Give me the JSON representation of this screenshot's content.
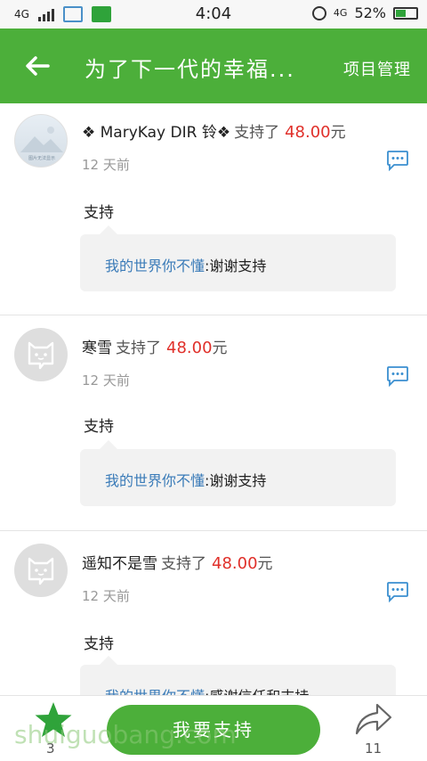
{
  "status_bar": {
    "network_left": "4G",
    "time": "4:04",
    "network_right": "4G",
    "battery": "52%",
    "battery_level": 0.52
  },
  "app_bar": {
    "title": "为了下一代的幸福...",
    "action": "项目管理"
  },
  "comments": [
    {
      "name": "❖ MaryKay  DIR 铃❖",
      "supported": "支持了",
      "amount": "48.00",
      "unit": "元",
      "time": "12 天前",
      "content": "支持",
      "reply_author": "我的世界你不懂",
      "reply_text": ":谢谢支持",
      "avatar_caption": "图片无法显示"
    },
    {
      "name": "寒雪",
      "supported": "支持了",
      "amount": "48.00",
      "unit": "元",
      "time": "12 天前",
      "content": "支持",
      "reply_author": "我的世界你不懂",
      "reply_text": ":谢谢支持"
    },
    {
      "name": "遥知不是雪",
      "supported": "支持了",
      "amount": "48.00",
      "unit": "元",
      "time": "12 天前",
      "content": "支持",
      "reply_author": "我的世界你不懂",
      "reply_text": ":感谢信任和支持"
    }
  ],
  "bottom_bar": {
    "star_count": "3",
    "support_label": "我要支持",
    "share_count": "11"
  },
  "watermark": "shuiguobang.com",
  "colors": {
    "primary": "#4caf3a",
    "amount": "#e0302a",
    "reply_author": "#3a7bb8"
  },
  "icons": [
    "back-arrow-icon",
    "comment-bubble-icon",
    "star-icon",
    "share-icon",
    "cat-avatar-icon",
    "alarm-icon",
    "battery-icon",
    "signal-icon"
  ]
}
